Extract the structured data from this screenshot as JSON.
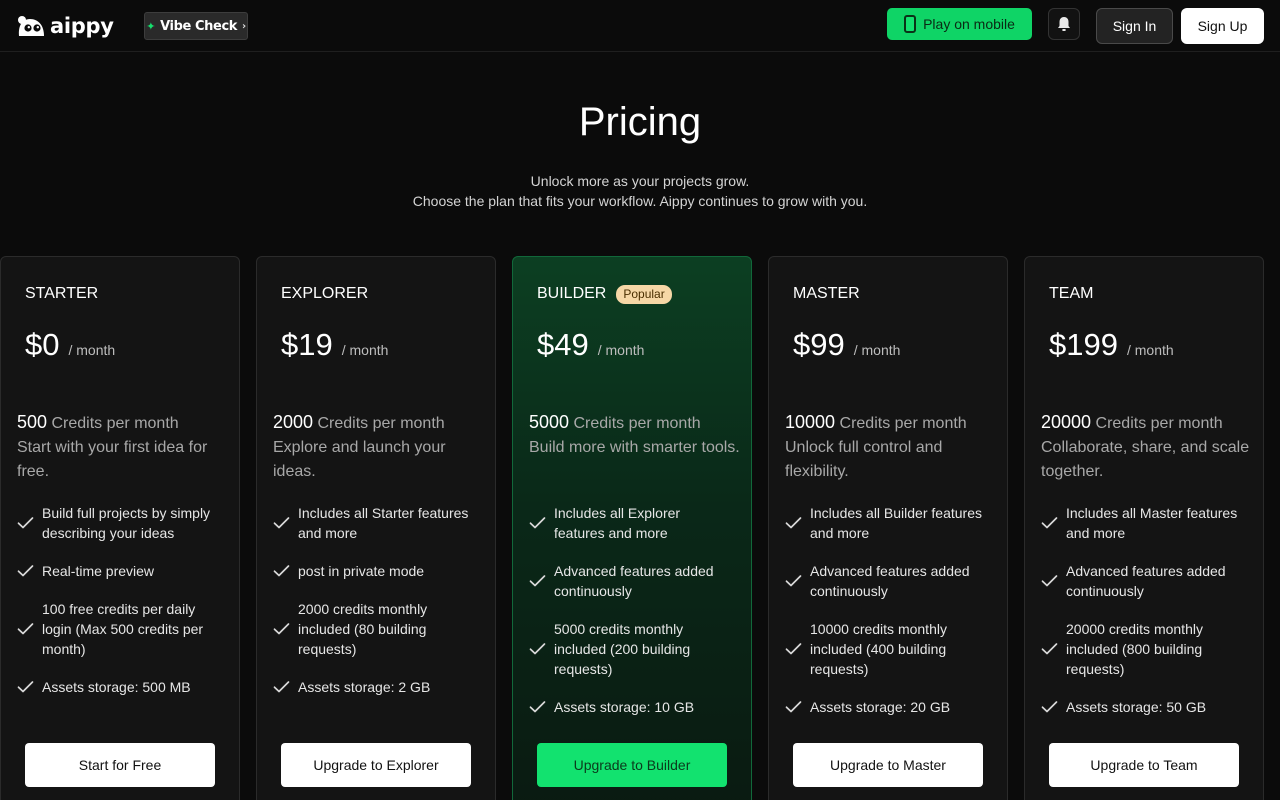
{
  "header": {
    "logo_text": "aippy",
    "vibe_check": "Vibe Check",
    "play_mobile": "Play on mobile",
    "sign_in": "Sign In",
    "sign_up": "Sign Up",
    "icons": [
      "logo-mascot-icon",
      "sparkle-icon",
      "chevron-right-icon",
      "phone-icon",
      "bell-icon"
    ],
    "colors": {
      "accent": "#12e26f",
      "background": "#0b0b0b"
    }
  },
  "hero": {
    "title": "Pricing",
    "subtitle_line1": "Unlock more as your projects grow.",
    "subtitle_line2": "Choose the plan that fits your workflow. Aippy continues to grow with you."
  },
  "plans": [
    {
      "name": "STARTER",
      "badge": "",
      "price": "$0",
      "period": "/ month",
      "credits": "500",
      "credits_label": "Credits per month",
      "tagline": "Start with your first idea for free.",
      "features": [
        "Build full projects by simply describing your ideas",
        "Real-time preview",
        "100 free credits per daily login (Max 500 credits per month)",
        "Assets storage: 500 MB"
      ],
      "cta": "Start for Free"
    },
    {
      "name": "EXPLORER",
      "badge": "",
      "price": "$19",
      "period": "/ month",
      "credits": "2000",
      "credits_label": "Credits per month",
      "tagline": "Explore and launch your ideas.",
      "features": [
        "Includes all Starter features and more",
        "post in private mode",
        "2000 credits monthly included (80 building requests)",
        "Assets storage: 2 GB"
      ],
      "cta": "Upgrade to Explorer"
    },
    {
      "name": "BUILDER",
      "badge": "Popular",
      "price": "$49",
      "period": "/ month",
      "credits": "5000",
      "credits_label": "Credits per month",
      "tagline": "Build more with smarter tools.",
      "features": [
        "Includes all Explorer features and more",
        "Advanced features added continuously",
        "5000 credits monthly included (200 building requests)",
        "Assets storage: 10 GB"
      ],
      "cta": "Upgrade to Builder"
    },
    {
      "name": "MASTER",
      "badge": "",
      "price": "$99",
      "period": "/ month",
      "credits": "10000",
      "credits_label": "Credits per month",
      "tagline": "Unlock full control and flexibility.",
      "features": [
        "Includes all Builder features and more",
        "Advanced features added continuously",
        "10000 credits monthly included (400 building requests)",
        "Assets storage: 20 GB"
      ],
      "cta": "Upgrade to Master"
    },
    {
      "name": "TEAM",
      "badge": "",
      "price": "$199",
      "period": "/ month",
      "credits": "20000",
      "credits_label": "Credits per month",
      "tagline": "Collaborate, share, and scale together.",
      "features": [
        "Includes all Master features and more",
        "Advanced features added continuously",
        "20000 credits monthly included (800 building requests)",
        "Assets storage: 50 GB"
      ],
      "cta": "Upgrade to Team"
    }
  ]
}
